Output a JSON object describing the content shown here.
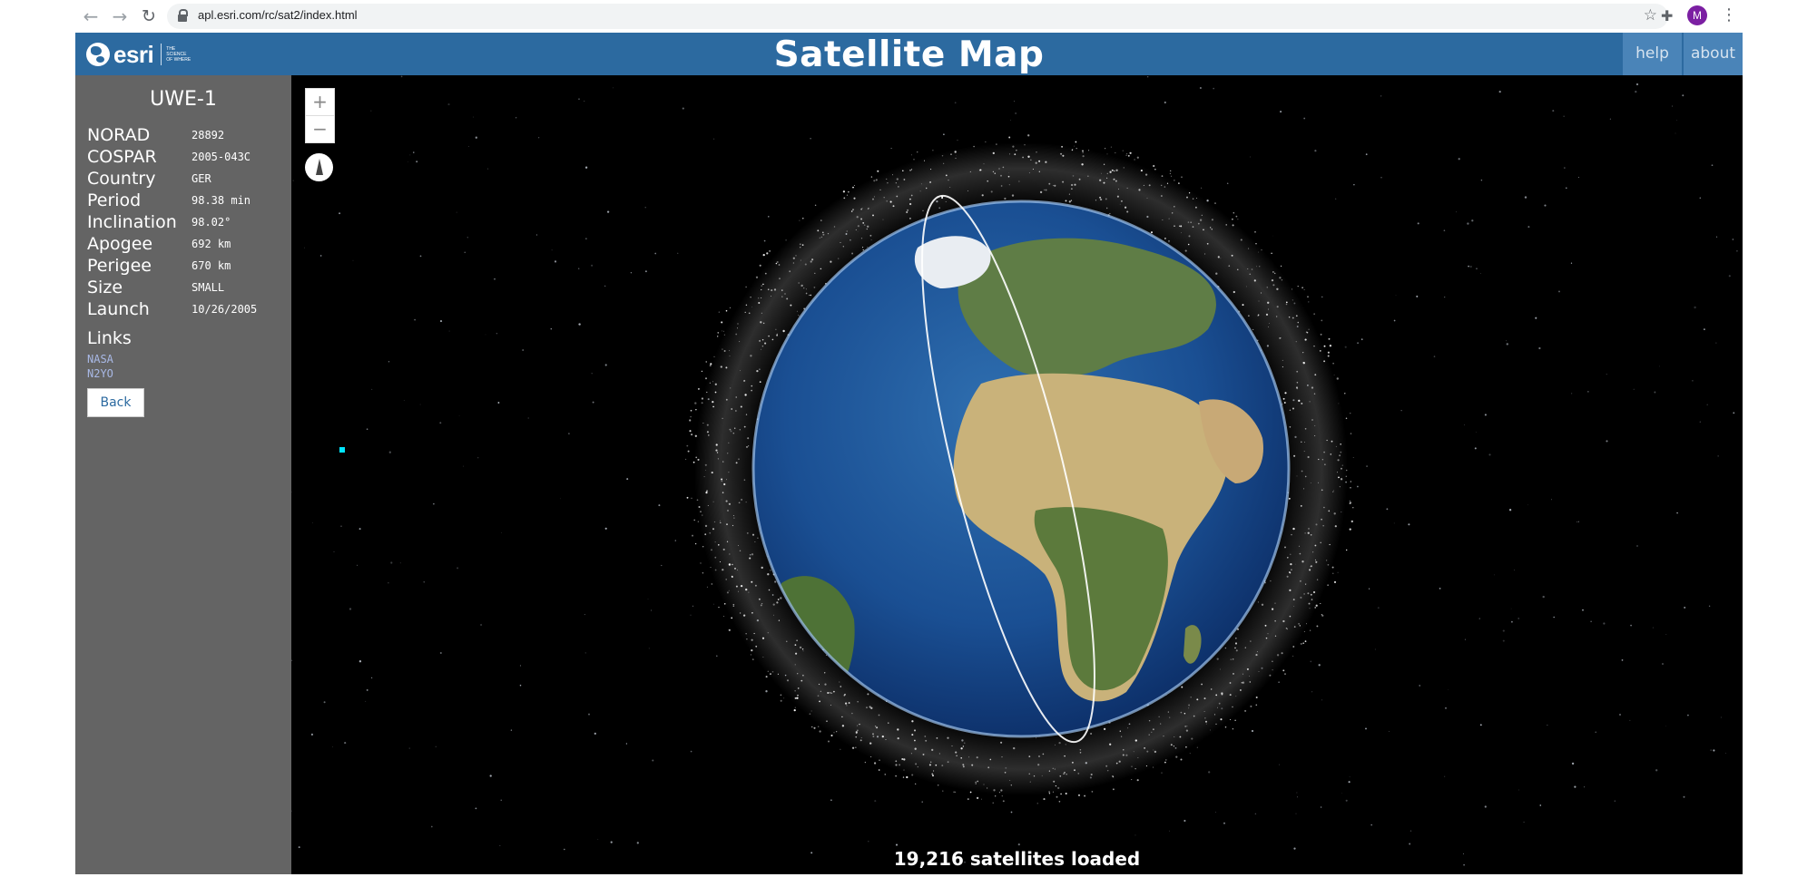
{
  "browser": {
    "url": "apl.esri.com/rc/sat2/index.html",
    "profile_initial": "M",
    "icons": [
      "back-arrow-icon",
      "forward-arrow-icon",
      "reload-icon",
      "lock-icon",
      "star-icon",
      "puzzle-icon",
      "kebab-icon"
    ]
  },
  "header": {
    "brand": "esri",
    "tagline": "THE SCIENCE OF WHERE",
    "title": "Satellite Map",
    "help_label": "help",
    "about_label": "about",
    "color": "#2c6aa0"
  },
  "satellite": {
    "name": "UWE-1",
    "fields": [
      {
        "label": "NORAD",
        "value": "28892"
      },
      {
        "label": "COSPAR",
        "value": "2005-043C"
      },
      {
        "label": "Country",
        "value": "GER"
      },
      {
        "label": "Period",
        "value": "98.38 min"
      },
      {
        "label": "Inclination",
        "value": "98.02°"
      },
      {
        "label": "Apogee",
        "value": "692 km"
      },
      {
        "label": "Perigee",
        "value": "670 km"
      },
      {
        "label": "Size",
        "value": "SMALL"
      },
      {
        "label": "Launch",
        "value": "10/26/2005"
      }
    ],
    "links_title": "Links",
    "links": [
      "NASA",
      "N2YO"
    ],
    "back_label": "Back"
  },
  "map": {
    "zoom_in": "+",
    "zoom_out": "−",
    "status": "19,216 satellites loaded"
  }
}
